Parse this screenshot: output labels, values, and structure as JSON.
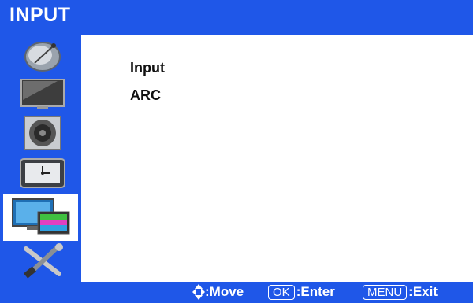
{
  "title": "INPUT",
  "colors": {
    "accent": "#1f57e8",
    "background": "#ffffff",
    "text": "#111111"
  },
  "sidebar": {
    "items": [
      {
        "icon": "satellite-dish-icon",
        "selected": false
      },
      {
        "icon": "tv-display-icon",
        "selected": false
      },
      {
        "icon": "speaker-icon",
        "selected": false
      },
      {
        "icon": "clock-icon",
        "selected": false
      },
      {
        "icon": "input-monitors-icon",
        "selected": true
      },
      {
        "icon": "tools-icon",
        "selected": false
      }
    ]
  },
  "menu": {
    "items": [
      {
        "label": "Input"
      },
      {
        "label": "ARC"
      }
    ]
  },
  "footer": {
    "move_label": ":Move",
    "ok_key": "OK",
    "enter_label": ":Enter",
    "menu_key": "MENU",
    "exit_label": ":Exit"
  }
}
